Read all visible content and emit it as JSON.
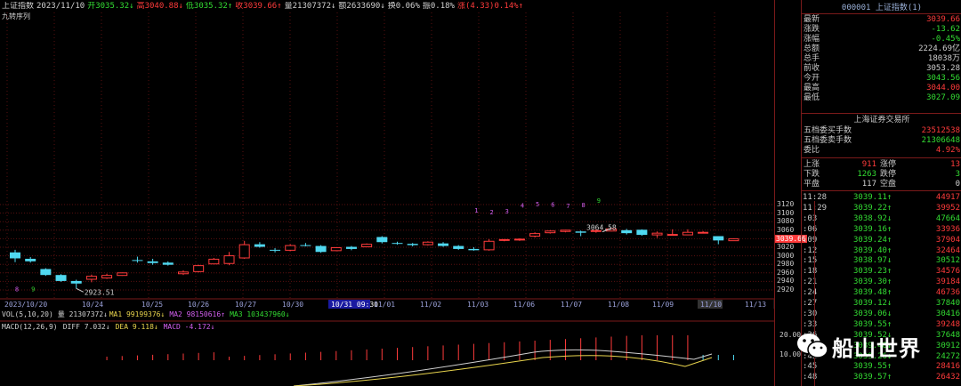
{
  "header": {
    "items": [
      {
        "label": "上证指数",
        "color": "#d0d0d0"
      },
      {
        "label": "2023/11/10",
        "color": "#d0d0d0"
      },
      {
        "label": "开3035.32↓",
        "color": "#33dd33"
      },
      {
        "label": "高3040.88↓",
        "color": "#ff3b3b"
      },
      {
        "label": "低3035.32↑",
        "color": "#33dd33"
      },
      {
        "label": "收3039.66↑",
        "color": "#ff3b3b"
      },
      {
        "label": "量21307372↓",
        "color": "#d0d0d0"
      },
      {
        "label": "额2633690↓",
        "color": "#d0d0d0"
      },
      {
        "label": "换0.06%",
        "color": "#d0d0d0"
      },
      {
        "label": "振0.18%",
        "color": "#d0d0d0"
      },
      {
        "label": "涨(4.33)0.14%↑",
        "color": "#ff3b3b"
      }
    ],
    "sub_label": "九转序列"
  },
  "chart_data": {
    "type": "candlestick",
    "interval": "15分钟",
    "y_ticks": [
      2920,
      2940,
      2960,
      2980,
      3000,
      3020,
      3040,
      3060,
      3080,
      3100,
      3120
    ],
    "current_price_tag": "3039.66",
    "x_labels": [
      "2023/10/20",
      "10/24",
      "10/25",
      "10/26",
      "10/27",
      "10/30",
      "10/31 09:30",
      "11/01",
      "11/02",
      "11/03",
      "11/06",
      "11/07",
      "11/08",
      "11/09",
      "11/10",
      "11/13"
    ],
    "annotations": {
      "low": "2923.51",
      "high": "3064.58"
    },
    "td_sequence": [
      {
        "label": "8",
        "color": "#d35ff0"
      },
      {
        "label": "9",
        "color": "#33dd33"
      },
      {
        "label": "1",
        "color": "#d35ff0"
      },
      {
        "label": "2",
        "color": "#d35ff0"
      },
      {
        "label": "3",
        "color": "#d35ff0"
      },
      {
        "label": "4",
        "color": "#d35ff0"
      },
      {
        "label": "5",
        "color": "#d35ff0"
      },
      {
        "label": "6",
        "color": "#d35ff0"
      },
      {
        "label": "7",
        "color": "#d35ff0"
      },
      {
        "label": "8",
        "color": "#d35ff0"
      },
      {
        "label": "9",
        "color": "#33dd33"
      }
    ],
    "candles": [
      {
        "o": 3008,
        "h": 3014,
        "c": 2994,
        "l": 2985
      },
      {
        "o": 2993,
        "h": 2997,
        "c": 2987,
        "l": 2984
      },
      {
        "o": 2969,
        "h": 2971,
        "c": 2955,
        "l": 2953
      },
      {
        "o": 2955,
        "h": 2957,
        "c": 2941,
        "l": 2939
      },
      {
        "o": 2941,
        "h": 2944,
        "c": 2935,
        "l": 2923.51
      },
      {
        "o": 2945,
        "h": 2956,
        "c": 2952,
        "l": 2938
      },
      {
        "o": 2948,
        "h": 2958,
        "c": 2954,
        "l": 2946
      },
      {
        "o": 2954,
        "h": 2961,
        "c": 2960,
        "l": 2953
      },
      {
        "o": 2990,
        "h": 2998,
        "c": 2989,
        "l": 2984
      },
      {
        "o": 2987,
        "h": 2993,
        "c": 2983,
        "l": 2979
      },
      {
        "o": 2984,
        "h": 2987,
        "c": 2979,
        "l": 2977
      },
      {
        "o": 2958,
        "h": 2966,
        "c": 2962,
        "l": 2955
      },
      {
        "o": 2963,
        "h": 2979,
        "c": 2977,
        "l": 2961
      },
      {
        "o": 2981,
        "h": 2995,
        "c": 2992,
        "l": 2980
      },
      {
        "o": 2982,
        "h": 3009,
        "c": 3000,
        "l": 2978
      },
      {
        "o": 2995,
        "h": 3035,
        "c": 3026,
        "l": 2993
      },
      {
        "o": 3027,
        "h": 3032,
        "c": 3021,
        "l": 3019
      },
      {
        "o": 3014,
        "h": 3018,
        "c": 3012,
        "l": 3008
      },
      {
        "o": 3013,
        "h": 3027,
        "c": 3024,
        "l": 3011
      },
      {
        "o": 3025,
        "h": 3030,
        "c": 3024,
        "l": 3022
      },
      {
        "o": 3023,
        "h": 3025,
        "c": 3009,
        "l": 3007
      },
      {
        "o": 3012,
        "h": 3020,
        "c": 3019,
        "l": 3011
      },
      {
        "o": 3021,
        "h": 3023,
        "c": 3016,
        "l": 3013
      },
      {
        "o": 3021,
        "h": 3029,
        "c": 3027,
        "l": 3020
      },
      {
        "o": 3044,
        "h": 3046,
        "c": 3032,
        "l": 3029
      },
      {
        "o": 3030,
        "h": 3033,
        "c": 3029,
        "l": 3026
      },
      {
        "o": 3028,
        "h": 3030,
        "c": 3025,
        "l": 3022
      },
      {
        "o": 3026,
        "h": 3034,
        "c": 3032,
        "l": 3024
      },
      {
        "o": 3029,
        "h": 3032,
        "c": 3023,
        "l": 3021
      },
      {
        "o": 3023,
        "h": 3025,
        "c": 3016,
        "l": 3014
      },
      {
        "o": 3016,
        "h": 3020,
        "c": 3013,
        "l": 3012
      },
      {
        "o": 3014,
        "h": 3039,
        "c": 3034,
        "l": 3012
      },
      {
        "o": 3036,
        "h": 3039,
        "c": 3038,
        "l": 3034
      },
      {
        "o": 3037,
        "h": 3041,
        "c": 3039,
        "l": 3035
      },
      {
        "o": 3046,
        "h": 3055,
        "c": 3052,
        "l": 3043
      },
      {
        "o": 3054,
        "h": 3060,
        "c": 3058,
        "l": 3052
      },
      {
        "o": 3057,
        "h": 3061,
        "c": 3060,
        "l": 3055
      },
      {
        "o": 3057,
        "h": 3059,
        "c": 3054,
        "l": 3046
      },
      {
        "o": 3057,
        "h": 3062,
        "c": 3059,
        "l": 3054
      },
      {
        "o": 3058,
        "h": 3064.58,
        "c": 3063,
        "l": 3057
      },
      {
        "o": 3060,
        "h": 3063,
        "c": 3053,
        "l": 3050
      },
      {
        "o": 3061,
        "h": 3062,
        "c": 3049,
        "l": 3047
      },
      {
        "o": 3049,
        "h": 3057,
        "c": 3053,
        "l": 3042
      },
      {
        "o": 3049,
        "h": 3062,
        "c": 3050,
        "l": 3048
      },
      {
        "o": 3049,
        "h": 3062,
        "c": 3055,
        "l": 3048
      },
      {
        "o": 3055,
        "h": 3058,
        "c": 3055,
        "l": 3053
      },
      {
        "o": 3046,
        "h": 3046,
        "c": 3036,
        "l": 3027
      },
      {
        "o": 3035.32,
        "h": 3040.88,
        "c": 3039.66,
        "l": 3035.32
      }
    ]
  },
  "indicators": {
    "vol": [
      {
        "text": "VOL(5,10,20)",
        "color": "#d0d0d0"
      },
      {
        "text": "量 21307372↓",
        "color": "#d0d0d0"
      },
      {
        "text": "MA1 99199376↓",
        "color": "#e8d44d"
      },
      {
        "text": "MA2 98150616↑",
        "color": "#d35ff0"
      },
      {
        "text": "MA3 103437960↓",
        "color": "#33dd33"
      }
    ],
    "macd": [
      {
        "text": "MACD(12,26,9)",
        "color": "#d0d0d0"
      },
      {
        "text": "DIFF 7.032↓",
        "color": "#d0d0d0"
      },
      {
        "text": "DEA 9.118↓",
        "color": "#e8d44d"
      },
      {
        "text": "MACD -4.172↓",
        "color": "#d35ff0"
      }
    ],
    "macd_ticks": [
      "20.00",
      "10.00"
    ]
  },
  "quote_panel": {
    "title": "000001 上证指数(1)",
    "rows": [
      {
        "label": "最新",
        "value": "3039.66",
        "color": "#ff3b3b"
      },
      {
        "label": "涨跌",
        "value": "-13.62",
        "color": "#33dd33"
      },
      {
        "label": "涨幅",
        "value": "-0.45%",
        "color": "#33dd33"
      },
      {
        "label": "总额",
        "value": "2224.69亿",
        "color": "#d0d0d0"
      },
      {
        "label": "总手",
        "value": "18038万",
        "color": "#d0d0d0"
      },
      {
        "label": "前收",
        "value": "3053.28",
        "color": "#d0d0d0"
      },
      {
        "label": "今开",
        "value": "3043.56",
        "color": "#33dd33"
      },
      {
        "label": "最高",
        "value": "3044.00",
        "color": "#ff3b3b"
      },
      {
        "label": "最低",
        "value": "3027.09",
        "color": "#33dd33"
      }
    ],
    "exchange": "上海证券交易所",
    "orders": [
      {
        "label": "五档委买手数",
        "value": "23512538",
        "color": "#ff3b3b"
      },
      {
        "label": "五档委卖手数",
        "value": "21306648",
        "color": "#33dd33"
      },
      {
        "label": "委比",
        "value": "4.92%",
        "color": "#ff3b3b"
      }
    ],
    "breadth": [
      {
        "label": "上涨",
        "count": "911",
        "count_color": "#ff3b3b",
        "sub": "涨停",
        "sub_val": "13",
        "sub_color": "#ff3b3b"
      },
      {
        "label": "下跌",
        "count": "1263",
        "count_color": "#33dd33",
        "sub": "跌停",
        "sub_val": "3",
        "sub_color": "#33dd33"
      },
      {
        "label": "平盘",
        "count": "117",
        "count_color": "#d0d0d0",
        "sub": "空盘",
        "sub_val": "0",
        "sub_color": "#d0d0d0"
      }
    ],
    "ticks": [
      {
        "time": "11:28",
        "price": "3039.11↑",
        "pc": "#33dd33",
        "vol": "44917",
        "vc": "#ff3b3b"
      },
      {
        "time": "11:29",
        "price": "3039.22↑",
        "pc": "#33dd33",
        "vol": "39952",
        "vc": "#ff3b3b"
      },
      {
        "time": ":03",
        "price": "3038.92↓",
        "pc": "#33dd33",
        "vol": "47664",
        "vc": "#33dd33"
      },
      {
        "time": ":06",
        "price": "3039.16↑",
        "pc": "#33dd33",
        "vol": "33936",
        "vc": "#ff3b3b"
      },
      {
        "time": ":09",
        "price": "3039.24↑",
        "pc": "#33dd33",
        "vol": "37904",
        "vc": "#ff3b3b"
      },
      {
        "time": ":12",
        "price": "3039.40↑",
        "pc": "#33dd33",
        "vol": "32464",
        "vc": "#ff3b3b"
      },
      {
        "time": ":15",
        "price": "3038.97↓",
        "pc": "#33dd33",
        "vol": "30512",
        "vc": "#33dd33"
      },
      {
        "time": ":18",
        "price": "3039.23↑",
        "pc": "#33dd33",
        "vol": "34576",
        "vc": "#ff3b3b"
      },
      {
        "time": ":21",
        "price": "3039.30↑",
        "pc": "#33dd33",
        "vol": "39184",
        "vc": "#ff3b3b"
      },
      {
        "time": ":24",
        "price": "3039.48↑",
        "pc": "#33dd33",
        "vol": "46736",
        "vc": "#ff3b3b"
      },
      {
        "time": ":27",
        "price": "3039.12↓",
        "pc": "#33dd33",
        "vol": "37840",
        "vc": "#33dd33"
      },
      {
        "time": ":30",
        "price": "3039.06↓",
        "pc": "#33dd33",
        "vol": "30416",
        "vc": "#33dd33"
      },
      {
        "time": ":33",
        "price": "3039.55↑",
        "pc": "#33dd33",
        "vol": "39248",
        "vc": "#ff3b3b"
      },
      {
        "time": ":36",
        "price": "3039.52↓",
        "pc": "#33dd33",
        "vol": "37648",
        "vc": "#33dd33"
      },
      {
        "time": ":39",
        "price": "3039.48↓",
        "pc": "#33dd33",
        "vol": "30912",
        "vc": "#33dd33"
      },
      {
        "time": ":42",
        "price": "3039.26↓",
        "pc": "#33dd33",
        "vol": "24272",
        "vc": "#33dd33"
      },
      {
        "time": ":45",
        "price": "3039.55↑",
        "pc": "#33dd33",
        "vol": "28416",
        "vc": "#ff3b3b"
      },
      {
        "time": ":48",
        "price": "3039.57↑",
        "pc": "#33dd33",
        "vol": "26432",
        "vc": "#ff3b3b"
      }
    ]
  },
  "watermark": {
    "text": "船山世界",
    "icon": "wechat-icon"
  }
}
